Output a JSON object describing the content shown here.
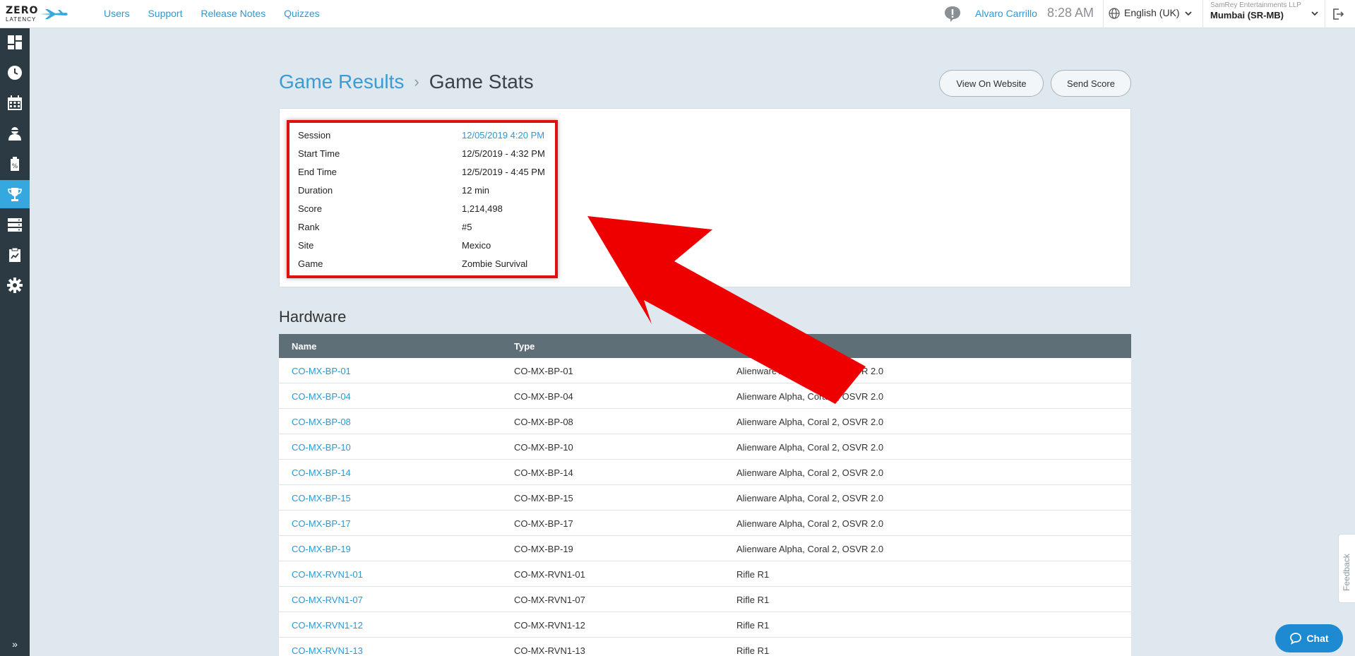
{
  "brand": {
    "line1": "ZERO",
    "line2": "LATENCY"
  },
  "nav": [
    "Users",
    "Support",
    "Release Notes",
    "Quizzes"
  ],
  "topbar": {
    "user": "Alvaro Carrillo",
    "time": "8:28 AM",
    "language": "English (UK)",
    "org_name": "SamRey Entertainments LLP",
    "org_site": "Mumbai (SR-MB)"
  },
  "sidebar": {
    "items": [
      {
        "icon": "dashboard-icon"
      },
      {
        "icon": "clock-icon"
      },
      {
        "icon": "calendar-icon"
      },
      {
        "icon": "player-icon"
      },
      {
        "icon": "voucher-icon"
      },
      {
        "icon": "trophy-icon",
        "active": true
      },
      {
        "icon": "server-icon"
      },
      {
        "icon": "report-icon"
      },
      {
        "icon": "settings-icon"
      }
    ],
    "expand_label": "»"
  },
  "breadcrumb": {
    "parent": "Game Results",
    "separator": "›",
    "current": "Game Stats"
  },
  "buttons": {
    "view_website": "View On Website",
    "send_score": "Send Score"
  },
  "session_info": [
    {
      "label": "Session",
      "value": "12/05/2019 4:20 PM",
      "link": true
    },
    {
      "label": "Start Time",
      "value": "12/5/2019 - 4:32 PM"
    },
    {
      "label": "End Time",
      "value": "12/5/2019 - 4:45 PM"
    },
    {
      "label": "Duration",
      "value": "12 min"
    },
    {
      "label": "Score",
      "value": "1,214,498"
    },
    {
      "label": "Rank",
      "value": "#5"
    },
    {
      "label": "Site",
      "value": "Mexico"
    },
    {
      "label": "Game",
      "value": "Zombie Survival"
    }
  ],
  "hardware": {
    "title": "Hardware",
    "columns": [
      "Name",
      "Type"
    ],
    "rows": [
      {
        "name": "CO-MX-BP-01",
        "type": "CO-MX-BP-01",
        "desc": "Alienware Alpha, Coral 2, OSVR 2.0"
      },
      {
        "name": "CO-MX-BP-04",
        "type": "CO-MX-BP-04",
        "desc": "Alienware Alpha, Coral 2, OSVR 2.0"
      },
      {
        "name": "CO-MX-BP-08",
        "type": "CO-MX-BP-08",
        "desc": "Alienware Alpha, Coral 2, OSVR 2.0"
      },
      {
        "name": "CO-MX-BP-10",
        "type": "CO-MX-BP-10",
        "desc": "Alienware Alpha, Coral 2, OSVR 2.0"
      },
      {
        "name": "CO-MX-BP-14",
        "type": "CO-MX-BP-14",
        "desc": "Alienware Alpha, Coral 2, OSVR 2.0"
      },
      {
        "name": "CO-MX-BP-15",
        "type": "CO-MX-BP-15",
        "desc": "Alienware Alpha, Coral 2, OSVR 2.0"
      },
      {
        "name": "CO-MX-BP-17",
        "type": "CO-MX-BP-17",
        "desc": "Alienware Alpha, Coral 2, OSVR 2.0"
      },
      {
        "name": "CO-MX-BP-19",
        "type": "CO-MX-BP-19",
        "desc": "Alienware Alpha, Coral 2, OSVR 2.0"
      },
      {
        "name": "CO-MX-RVN1-01",
        "type": "CO-MX-RVN1-01",
        "desc": "Rifle R1"
      },
      {
        "name": "CO-MX-RVN1-07",
        "type": "CO-MX-RVN1-07",
        "desc": "Rifle R1"
      },
      {
        "name": "CO-MX-RVN1-12",
        "type": "CO-MX-RVN1-12",
        "desc": "Rifle R1"
      },
      {
        "name": "CO-MX-RVN1-13",
        "type": "CO-MX-RVN1-13",
        "desc": "Rifle R1"
      }
    ]
  },
  "feedback_label": "Feedback",
  "chat_label": "Chat",
  "colors": {
    "accent": "#2a9ad6",
    "sidebar": "#2c3a44",
    "highlight": "#e01010"
  }
}
